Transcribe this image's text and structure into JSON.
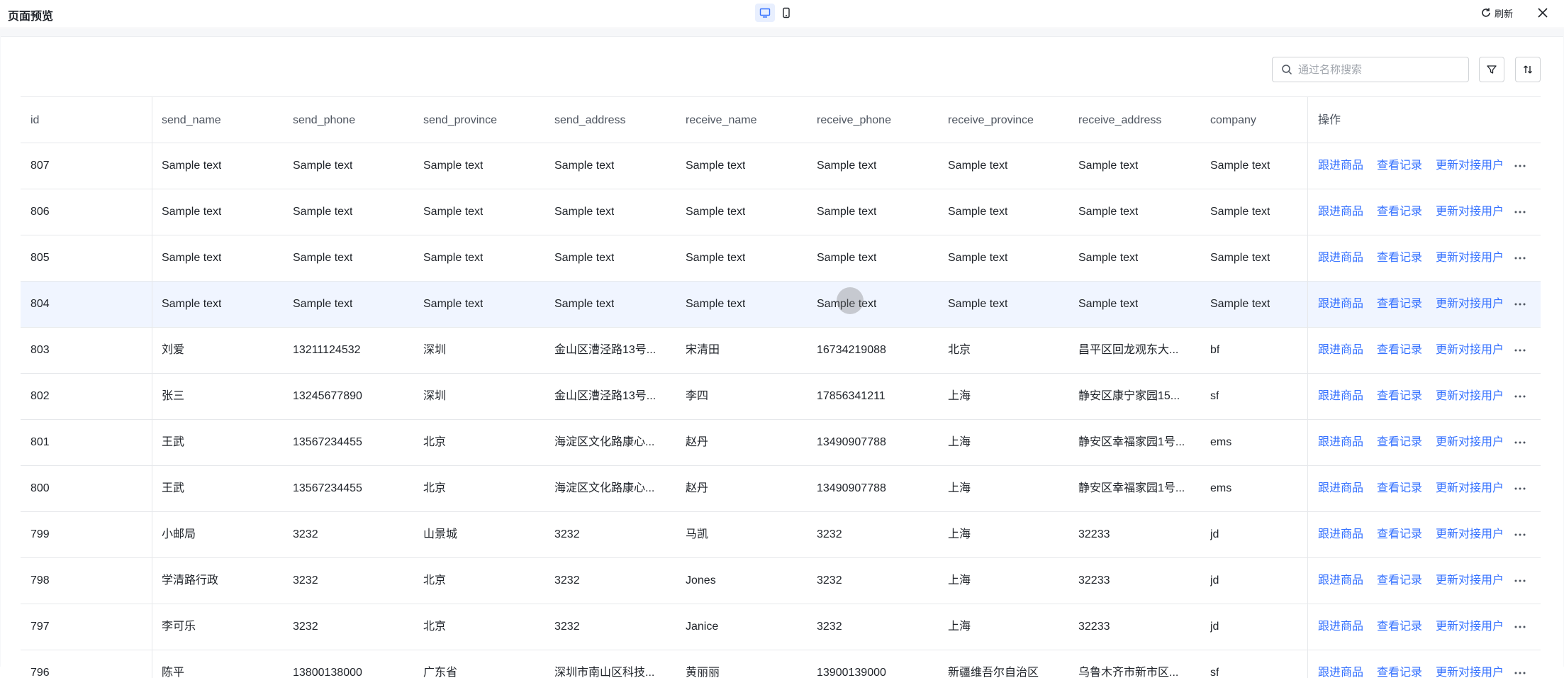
{
  "topbar": {
    "title": "页面预览",
    "devices": [
      {
        "name": "desktop",
        "icon": "desktop-icon",
        "active": true
      },
      {
        "name": "mobile",
        "icon": "mobile-icon",
        "active": false
      }
    ],
    "refresh_label": "刷新",
    "close_icon": "close-icon"
  },
  "toolbar": {
    "search_placeholder": "通过名称搜索",
    "filter_icon": "filter-icon",
    "sort_icon": "sort-icon"
  },
  "table": {
    "columns": [
      "id",
      "send_name",
      "send_phone",
      "send_province",
      "send_address",
      "receive_name",
      "receive_phone",
      "receive_province",
      "receive_address",
      "company",
      "操作"
    ],
    "actions": [
      "跟进商品",
      "查看记录",
      "更新对接用户"
    ],
    "rows": [
      [
        "807",
        "Sample text",
        "Sample text",
        "Sample text",
        "Sample text",
        "Sample text",
        "Sample text",
        "Sample text",
        "Sample text",
        "Sample text"
      ],
      [
        "806",
        "Sample text",
        "Sample text",
        "Sample text",
        "Sample text",
        "Sample text",
        "Sample text",
        "Sample text",
        "Sample text",
        "Sample text"
      ],
      [
        "805",
        "Sample text",
        "Sample text",
        "Sample text",
        "Sample text",
        "Sample text",
        "Sample text",
        "Sample text",
        "Sample text",
        "Sample text"
      ],
      [
        "804",
        "Sample text",
        "Sample text",
        "Sample text",
        "Sample text",
        "Sample text",
        "Sample text",
        "Sample text",
        "Sample text",
        "Sample text"
      ],
      [
        "803",
        "刘爱",
        "13211124532",
        "深圳",
        "金山区漕泾路13号...",
        "宋清田",
        "16734219088",
        "北京",
        "昌平区回龙观东大...",
        "bf"
      ],
      [
        "802",
        "张三",
        "13245677890",
        "深圳",
        "金山区漕泾路13号...",
        "李四",
        "17856341211",
        "上海",
        "静安区康宁家园15...",
        "sf"
      ],
      [
        "801",
        "王武",
        "13567234455",
        "北京",
        "海淀区文化路康心...",
        "赵丹",
        "13490907788",
        "上海",
        "静安区幸福家园1号...",
        "ems"
      ],
      [
        "800",
        "王武",
        "13567234455",
        "北京",
        "海淀区文化路康心...",
        "赵丹",
        "13490907788",
        "上海",
        "静安区幸福家园1号...",
        "ems"
      ],
      [
        "799",
        "小邮局",
        "3232",
        "山景城",
        "3232",
        "马凯",
        "3232",
        "上海",
        "32233",
        "jd"
      ],
      [
        "798",
        "学清路行政",
        "3232",
        "北京",
        "3232",
        "Jones",
        "3232",
        "上海",
        "32233",
        "jd"
      ],
      [
        "797",
        "李可乐",
        "3232",
        "北京",
        "3232",
        "Janice",
        "3232",
        "上海",
        "32233",
        "jd"
      ],
      [
        "796",
        "陈平",
        "13800138000",
        "广东省",
        "深圳市南山区科技...",
        "黄丽丽",
        "13900139000",
        "新疆维吾尔自治区",
        "乌鲁木齐市新市区...",
        "sf"
      ]
    ],
    "highlighted_row": 3
  }
}
